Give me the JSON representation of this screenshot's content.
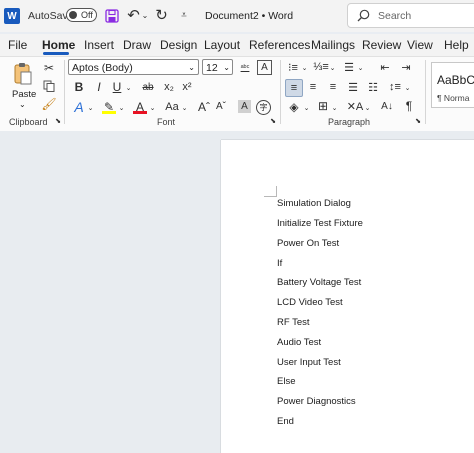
{
  "titlebar": {
    "autosave_label": "AutoSave",
    "autosave_state": "Off",
    "doc_title": "Document2 • Word",
    "search_placeholder": "Search"
  },
  "tabs": [
    "File",
    "Home",
    "Insert",
    "Draw",
    "Design",
    "Layout",
    "References",
    "Mailings",
    "Review",
    "View",
    "Help"
  ],
  "active_tab": "Home",
  "ribbon": {
    "paste_label": "Paste",
    "font_name": "Aptos (Body)",
    "font_size": "12",
    "style_preview": "AaBbC",
    "style_name": "¶ Norma",
    "groups": {
      "clipboard": "Clipboard",
      "font": "Font",
      "paragraph": "Paragraph"
    }
  },
  "document": {
    "lines": [
      "Simulation Dialog",
      "Initialize Test Fixture",
      "Power On Test",
      "If",
      "Battery Voltage Test",
      "LCD Video Test",
      "RF Test",
      "Audio Test",
      "User Input Test",
      "Else",
      "Power Diagnostics",
      "End"
    ]
  },
  "colors": {
    "accent": "#185abd",
    "word_icon": "#185abd",
    "highlight": "#ffff00",
    "font_color": "#e81123"
  }
}
